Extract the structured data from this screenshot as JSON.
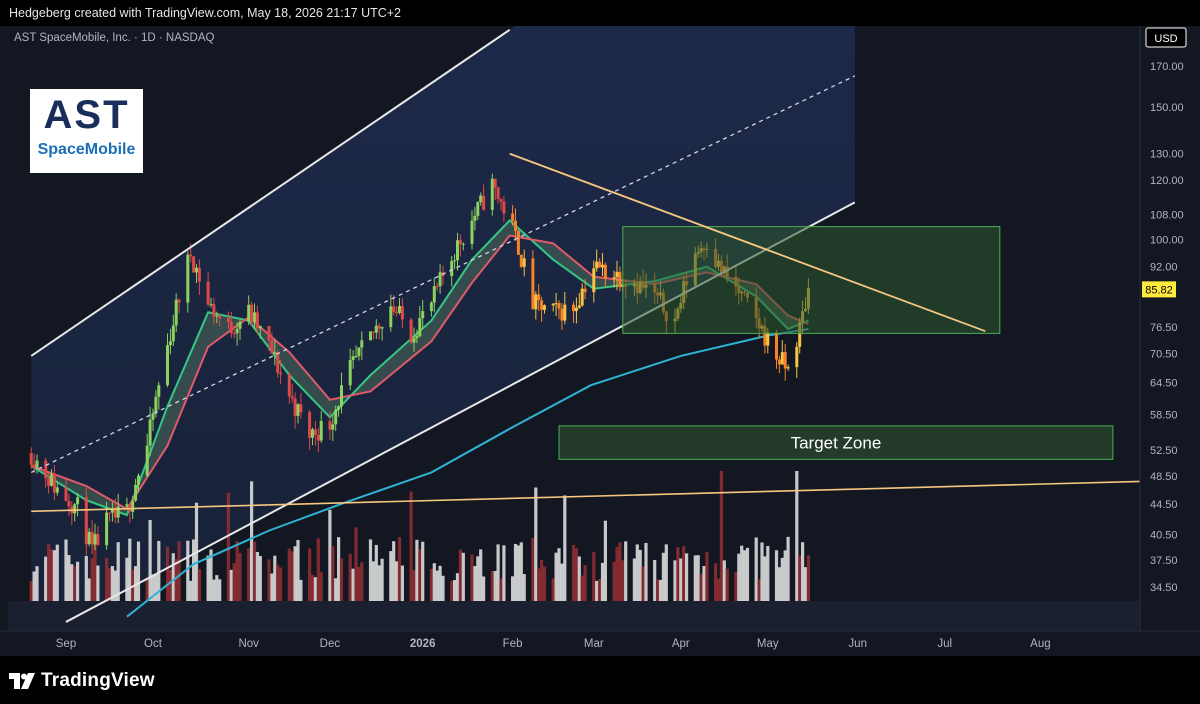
{
  "header": {
    "attribution": "Hedgeberg created with TradingView.com, May 18, 2026 21:17 UTC+2"
  },
  "footer": {
    "brand": "TradingView"
  },
  "logo": {
    "line1": "AST",
    "line2": "SpaceMobile"
  },
  "colors": {
    "background": "#131722",
    "channel_fill": "#1b2844",
    "up_candle": "#8bd25e",
    "up_candle_late": "#f6c343",
    "down_candle": "#e04848",
    "down_candle_late": "#f5832a",
    "ma_fast": "#35c784",
    "ma_slow": "#e05a6a",
    "ma_long": "#2fb3d4",
    "trendline": "#f6c77f",
    "zone_fill": "#2e5a30",
    "zone_border": "#4caf50",
    "price_tag": "#ffeb3b"
  },
  "chart_data": {
    "type": "candlestick",
    "symbol_label": "AST SpaceMobile, Inc. · 1D · NASDAQ",
    "currency": "USD",
    "last_price": 85.82,
    "price_scale": "log",
    "ylim": [
      31.0,
      190.0
    ],
    "yticks": [
      170.0,
      150.0,
      130.0,
      120.0,
      108.0,
      100.0,
      92.0,
      85.82,
      76.5,
      70.5,
      64.5,
      58.5,
      52.5,
      48.5,
      44.5,
      40.5,
      37.5,
      34.5
    ],
    "ytick_labels": [
      "170.00",
      "150.00",
      "130.00",
      "120.00",
      "108.00",
      "100.00",
      "92.00",
      "85.82",
      "76.50",
      "70.50",
      "64.50",
      "58.50",
      "52.50",
      "48.50",
      "44.50",
      "40.50",
      "37.50",
      "34.50"
    ],
    "xticks": [
      {
        "label": "Sep",
        "date": "2025-09-01",
        "bold": false
      },
      {
        "label": "Oct",
        "date": "2025-10-01",
        "bold": false
      },
      {
        "label": "Nov",
        "date": "2025-11-03",
        "bold": false
      },
      {
        "label": "Dec",
        "date": "2025-12-01",
        "bold": false
      },
      {
        "label": "2026",
        "date": "2026-01-02",
        "bold": true
      },
      {
        "label": "Feb",
        "date": "2026-02-02",
        "bold": false
      },
      {
        "label": "Mar",
        "date": "2026-03-02",
        "bold": false
      },
      {
        "label": "Apr",
        "date": "2026-04-01",
        "bold": false
      },
      {
        "label": "May",
        "date": "2026-05-01",
        "bold": false
      },
      {
        "label": "Jun",
        "date": "2026-06-01",
        "bold": false
      },
      {
        "label": "Jul",
        "date": "2026-07-01",
        "bold": false
      },
      {
        "label": "Aug",
        "date": "2026-08-03",
        "bold": false
      }
    ],
    "price_path": [
      {
        "date": "2025-08-20",
        "value": 52.0
      },
      {
        "date": "2025-08-28",
        "value": 47.0
      },
      {
        "date": "2025-09-05",
        "value": 44.0
      },
      {
        "date": "2025-09-10",
        "value": 38.5
      },
      {
        "date": "2025-09-15",
        "value": 42.0
      },
      {
        "date": "2025-09-22",
        "value": 43.5
      },
      {
        "date": "2025-09-29",
        "value": 53.0
      },
      {
        "date": "2025-10-06",
        "value": 72.0
      },
      {
        "date": "2025-10-10",
        "value": 84.0
      },
      {
        "date": "2025-10-14",
        "value": 96.0
      },
      {
        "date": "2025-10-20",
        "value": 82.0
      },
      {
        "date": "2025-10-27",
        "value": 76.0
      },
      {
        "date": "2025-11-03",
        "value": 80.0
      },
      {
        "date": "2025-11-10",
        "value": 72.0
      },
      {
        "date": "2025-11-17",
        "value": 62.0
      },
      {
        "date": "2025-11-24",
        "value": 55.0
      },
      {
        "date": "2025-12-01",
        "value": 57.0
      },
      {
        "date": "2025-12-08",
        "value": 67.0
      },
      {
        "date": "2025-12-15",
        "value": 74.0
      },
      {
        "date": "2025-12-22",
        "value": 82.0
      },
      {
        "date": "2025-12-29",
        "value": 75.0
      },
      {
        "date": "2026-01-05",
        "value": 82.0
      },
      {
        "date": "2026-01-12",
        "value": 95.0
      },
      {
        "date": "2026-01-19",
        "value": 106.0
      },
      {
        "date": "2026-01-26",
        "value": 118.0
      },
      {
        "date": "2026-02-01",
        "value": 106.0
      },
      {
        "date": "2026-02-04",
        "value": 98.0
      },
      {
        "date": "2026-02-09",
        "value": 82.0
      },
      {
        "date": "2026-02-16",
        "value": 80.0
      },
      {
        "date": "2026-02-23",
        "value": 81.0
      },
      {
        "date": "2026-03-02",
        "value": 92.0
      },
      {
        "date": "2026-03-09",
        "value": 90.0
      },
      {
        "date": "2026-03-16",
        "value": 88.0
      },
      {
        "date": "2026-03-23",
        "value": 84.0
      },
      {
        "date": "2026-03-30",
        "value": 78.0
      },
      {
        "date": "2026-04-06",
        "value": 96.0
      },
      {
        "date": "2026-04-10",
        "value": 100.0
      },
      {
        "date": "2026-04-14",
        "value": 92.0
      },
      {
        "date": "2026-04-20",
        "value": 86.0
      },
      {
        "date": "2026-04-27",
        "value": 78.0
      },
      {
        "date": "2026-05-04",
        "value": 70.0
      },
      {
        "date": "2026-05-08",
        "value": 67.0
      },
      {
        "date": "2026-05-12",
        "value": 76.0
      },
      {
        "date": "2026-05-15",
        "value": 85.82
      }
    ],
    "volume_panel": "bars at bottom of price pane, mix of white and dark red",
    "overlays": {
      "upper_channel_line": {
        "points": [
          {
            "date": "2025-08-20",
            "value": 70.0
          },
          {
            "date": "2026-02-01",
            "value": 190.0
          }
        ]
      },
      "channel_mid_line_dashed": {
        "points": [
          {
            "date": "2025-08-20",
            "value": 49.0
          },
          {
            "date": "2026-05-31",
            "value": 165.0
          }
        ]
      },
      "lower_channel_line": {
        "points": [
          {
            "date": "2025-09-01",
            "value": 31.0
          },
          {
            "date": "2026-05-31",
            "value": 112.0
          }
        ]
      },
      "descending_trendline": {
        "points": [
          {
            "date": "2026-02-01",
            "value": 130.0
          },
          {
            "date": "2026-07-15",
            "value": 75.5
          }
        ]
      },
      "horizontal_trendline": {
        "points": [
          {
            "date": "2025-08-20",
            "value": 43.5
          },
          {
            "date": "2026-09-18",
            "value": 47.8
          }
        ]
      },
      "consolidation_box": {
        "x0": "2026-03-12",
        "x1": "2026-07-20",
        "y0": 75.0,
        "y1": 104.0
      },
      "target_zone": {
        "label": "Target Zone",
        "x0": "2026-02-18",
        "x1": "2026-08-28",
        "y0": 51.0,
        "y1": 56.5
      }
    }
  }
}
